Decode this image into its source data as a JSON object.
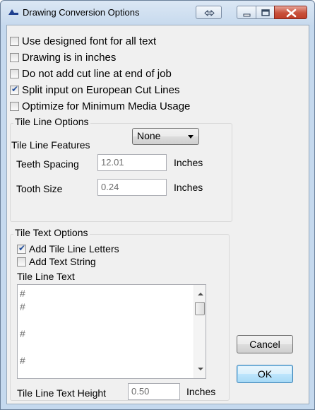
{
  "window": {
    "title": "Drawing Conversion Options",
    "controls": [
      "swap-icon",
      "minimize-icon",
      "maximize-icon",
      "close-icon"
    ]
  },
  "options": [
    {
      "label": "Use designed font for all text",
      "checked": false
    },
    {
      "label": "Drawing is in inches",
      "checked": false
    },
    {
      "label": "Do not add cut line at end of job",
      "checked": false
    },
    {
      "label": "Split input on European Cut Lines",
      "checked": true
    },
    {
      "label": "Optimize for Minimum Media Usage",
      "checked": false
    }
  ],
  "tile_line_options": {
    "title": "Tile Line Options",
    "features_label": "Tile Line Features",
    "features_value": "None",
    "teeth_spacing_label": "Teeth Spacing",
    "teeth_spacing_value": "12.01",
    "teeth_spacing_unit": "Inches",
    "tooth_size_label": "Tooth Size",
    "tooth_size_value": "0.24",
    "tooth_size_unit": "Inches"
  },
  "tile_text_options": {
    "title": "Tile Text Options",
    "add_letters_label": "Add Tile Line Letters",
    "add_letters_checked": true,
    "add_text_label": "Add Text String",
    "add_text_checked": false,
    "text_label": "Tile Line Text",
    "text_lines": [
      "#",
      "#",
      "",
      "#",
      "",
      "#"
    ],
    "height_label": "Tile Line Text Height",
    "height_value": "0.50",
    "height_unit": "Inches"
  },
  "buttons": {
    "cancel": "Cancel",
    "ok": "OK"
  },
  "colors": {
    "title_bar": "#c7daee",
    "close_button": "#c8503b",
    "check_mark": "#234f9c",
    "default_button_border": "#3c7fb1"
  }
}
